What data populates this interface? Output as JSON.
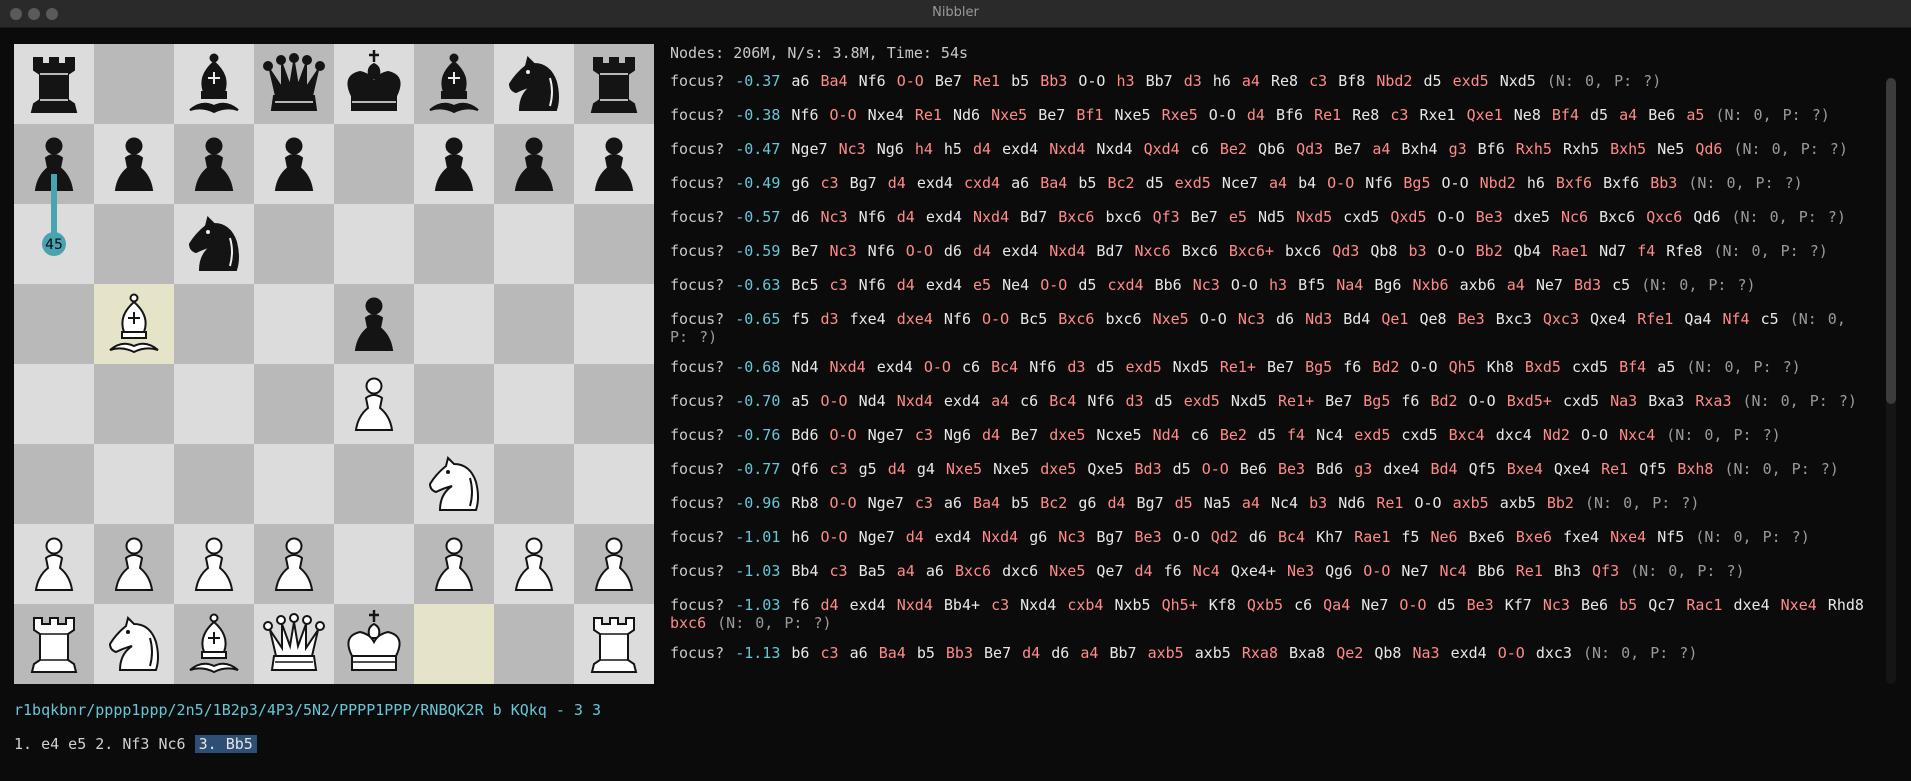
{
  "window": {
    "title": "Nibbler"
  },
  "info": {
    "text": "Nodes: 206M, N/s: 3.8M, Time: 54s"
  },
  "board": {
    "rows": [
      [
        "r",
        "",
        "b",
        "q",
        "k",
        "b",
        "n",
        "r"
      ],
      [
        "p",
        "p",
        "p",
        "p",
        "",
        "p",
        "p",
        "p"
      ],
      [
        "",
        "",
        "n",
        "",
        "",
        "",
        "",
        ""
      ],
      [
        "",
        "B",
        "",
        "",
        "p",
        "",
        "",
        ""
      ],
      [
        "",
        "",
        "",
        "",
        "P",
        "",
        "",
        ""
      ],
      [
        "",
        "",
        "",
        "",
        "",
        "N",
        "",
        ""
      ],
      [
        "P",
        "P",
        "P",
        "P",
        "",
        "P",
        "P",
        "P"
      ],
      [
        "R",
        "N",
        "B",
        "Q",
        "K",
        "",
        "",
        "R"
      ]
    ],
    "highlight": [
      "b5",
      "f1"
    ],
    "arrow": {
      "from": "a7",
      "to": "a6",
      "label": "45",
      "color": "#4aa3b0"
    }
  },
  "colors": {
    "score": "#66c6d6",
    "white_move": "#e8e8e8",
    "black_move": "#ff8a8a",
    "fen": "#66c6d6",
    "current_move_bg": "#2c4f73"
  },
  "pv_lines": [
    {
      "label": "focus?",
      "score": "-0.37",
      "moves": [
        "a6",
        "Ba4",
        "Nf6",
        "O-O",
        "Be7",
        "Re1",
        "b5",
        "Bb3",
        "O-O",
        "h3",
        "Bb7",
        "d3",
        "h6",
        "a4",
        "Re8",
        "c3",
        "Bf8",
        "Nbd2",
        "d5",
        "exd5",
        "Nxd5"
      ],
      "stats": "(N: 0, P: ?)"
    },
    {
      "label": "focus?",
      "score": "-0.38",
      "moves": [
        "Nf6",
        "O-O",
        "Nxe4",
        "Re1",
        "Nd6",
        "Nxe5",
        "Be7",
        "Bf1",
        "Nxe5",
        "Rxe5",
        "O-O",
        "d4",
        "Bf6",
        "Re1",
        "Re8",
        "c3",
        "Rxe1",
        "Qxe1",
        "Ne8",
        "Bf4",
        "d5",
        "a4",
        "Be6",
        "a5"
      ],
      "stats": "(N: 0, P: ?)"
    },
    {
      "label": "focus?",
      "score": "-0.47",
      "moves": [
        "Nge7",
        "Nc3",
        "Ng6",
        "h4",
        "h5",
        "d4",
        "exd4",
        "Nxd4",
        "Nxd4",
        "Qxd4",
        "c6",
        "Be2",
        "Qb6",
        "Qd3",
        "Be7",
        "a4",
        "Bxh4",
        "g3",
        "Bf6",
        "Rxh5",
        "Rxh5",
        "Bxh5",
        "Ne5",
        "Qd6"
      ],
      "stats": "(N: 0, P: ?)"
    },
    {
      "label": "focus?",
      "score": "-0.49",
      "moves": [
        "g6",
        "c3",
        "Bg7",
        "d4",
        "exd4",
        "cxd4",
        "a6",
        "Ba4",
        "b5",
        "Bc2",
        "d5",
        "exd5",
        "Nce7",
        "a4",
        "b4",
        "O-O",
        "Nf6",
        "Bg5",
        "O-O",
        "Nbd2",
        "h6",
        "Bxf6",
        "Bxf6",
        "Bb3"
      ],
      "stats": "(N: 0, P: ?)"
    },
    {
      "label": "focus?",
      "score": "-0.57",
      "moves": [
        "d6",
        "Nc3",
        "Nf6",
        "d4",
        "exd4",
        "Nxd4",
        "Bd7",
        "Bxc6",
        "bxc6",
        "Qf3",
        "Be7",
        "e5",
        "Nd5",
        "Nxd5",
        "cxd5",
        "Qxd5",
        "O-O",
        "Be3",
        "dxe5",
        "Nc6",
        "Bxc6",
        "Qxc6",
        "Qd6"
      ],
      "stats": "(N: 0, P: ?)"
    },
    {
      "label": "focus?",
      "score": "-0.59",
      "moves": [
        "Be7",
        "Nc3",
        "Nf6",
        "O-O",
        "d6",
        "d4",
        "exd4",
        "Nxd4",
        "Bd7",
        "Nxc6",
        "Bxc6",
        "Bxc6+",
        "bxc6",
        "Qd3",
        "Qb8",
        "b3",
        "O-O",
        "Bb2",
        "Qb4",
        "Rae1",
        "Nd7",
        "f4",
        "Rfe8"
      ],
      "stats": "(N: 0, P: ?)"
    },
    {
      "label": "focus?",
      "score": "-0.63",
      "moves": [
        "Bc5",
        "c3",
        "Nf6",
        "d4",
        "exd4",
        "e5",
        "Ne4",
        "O-O",
        "d5",
        "cxd4",
        "Bb6",
        "Nc3",
        "O-O",
        "h3",
        "Bf5",
        "Na4",
        "Bg6",
        "Nxb6",
        "axb6",
        "a4",
        "Ne7",
        "Bd3",
        "c5"
      ],
      "stats": "(N: 0, P: ?)"
    },
    {
      "label": "focus?",
      "score": "-0.65",
      "moves": [
        "f5",
        "d3",
        "fxe4",
        "dxe4",
        "Nf6",
        "O-O",
        "Bc5",
        "Bxc6",
        "bxc6",
        "Nxe5",
        "O-O",
        "Nc3",
        "d6",
        "Nd3",
        "Bd4",
        "Qe1",
        "Qe8",
        "Be3",
        "Bxc3",
        "Qxc3",
        "Qxe4",
        "Rfe1",
        "Qa4",
        "Nf4",
        "c5"
      ],
      "stats": "(N: 0, P: ?)",
      "tight": true
    },
    {
      "label": "focus?",
      "score": "-0.68",
      "moves": [
        "Nd4",
        "Nxd4",
        "exd4",
        "O-O",
        "c6",
        "Bc4",
        "Nf6",
        "d3",
        "d5",
        "exd5",
        "Nxd5",
        "Re1+",
        "Be7",
        "Bg5",
        "f6",
        "Bd2",
        "O-O",
        "Qh5",
        "Kh8",
        "Bxd5",
        "cxd5",
        "Bf4",
        "a5"
      ],
      "stats": "(N: 0, P: ?)"
    },
    {
      "label": "focus?",
      "score": "-0.70",
      "moves": [
        "a5",
        "O-O",
        "Nd4",
        "Nxd4",
        "exd4",
        "a4",
        "c6",
        "Bc4",
        "Nf6",
        "d3",
        "d5",
        "exd5",
        "Nxd5",
        "Re1+",
        "Be7",
        "Bg5",
        "f6",
        "Bd2",
        "O-O",
        "Bxd5+",
        "cxd5",
        "Na3",
        "Bxa3",
        "Rxa3"
      ],
      "stats": "(N: 0, P: ?)"
    },
    {
      "label": "focus?",
      "score": "-0.76",
      "moves": [
        "Bd6",
        "O-O",
        "Nge7",
        "c3",
        "Ng6",
        "d4",
        "Be7",
        "dxe5",
        "Ncxe5",
        "Nd4",
        "c6",
        "Be2",
        "d5",
        "f4",
        "Nc4",
        "exd5",
        "cxd5",
        "Bxc4",
        "dxc4",
        "Nd2",
        "O-O",
        "Nxc4"
      ],
      "stats": "(N: 0, P: ?)"
    },
    {
      "label": "focus?",
      "score": "-0.77",
      "moves": [
        "Qf6",
        "c3",
        "g5",
        "d4",
        "g4",
        "Nxe5",
        "Nxe5",
        "dxe5",
        "Qxe5",
        "Bd3",
        "d5",
        "O-O",
        "Be6",
        "Be3",
        "Bd6",
        "g3",
        "dxe4",
        "Bd4",
        "Qf5",
        "Bxe4",
        "Qxe4",
        "Re1",
        "Qf5",
        "Bxh8"
      ],
      "stats": "(N: 0, P: ?)"
    },
    {
      "label": "focus?",
      "score": "-0.96",
      "moves": [
        "Rb8",
        "O-O",
        "Nge7",
        "c3",
        "a6",
        "Ba4",
        "b5",
        "Bc2",
        "g6",
        "d4",
        "Bg7",
        "d5",
        "Na5",
        "a4",
        "Nc4",
        "b3",
        "Nd6",
        "Re1",
        "O-O",
        "axb5",
        "axb5",
        "Bb2"
      ],
      "stats": "(N: 0, P: ?)"
    },
    {
      "label": "focus?",
      "score": "-1.01",
      "moves": [
        "h6",
        "O-O",
        "Nge7",
        "d4",
        "exd4",
        "Nxd4",
        "g6",
        "Nc3",
        "Bg7",
        "Be3",
        "O-O",
        "Qd2",
        "d6",
        "Bc4",
        "Kh7",
        "Rae1",
        "f5",
        "Ne6",
        "Bxe6",
        "Bxe6",
        "fxe4",
        "Nxe4",
        "Nf5"
      ],
      "stats": "(N: 0, P: ?)"
    },
    {
      "label": "focus?",
      "score": "-1.03",
      "moves": [
        "Bb4",
        "c3",
        "Ba5",
        "a4",
        "a6",
        "Bxc6",
        "dxc6",
        "Nxe5",
        "Qe7",
        "d4",
        "f6",
        "Nc4",
        "Qxe4+",
        "Ne3",
        "Qg6",
        "O-O",
        "Ne7",
        "Nc4",
        "Bb6",
        "Re1",
        "Bh3",
        "Qf3"
      ],
      "stats": "(N: 0, P: ?)"
    },
    {
      "label": "focus?",
      "score": "-1.03",
      "moves": [
        "f6",
        "d4",
        "exd4",
        "Nxd4",
        "Bb4+",
        "c3",
        "Nxd4",
        "cxb4",
        "Nxb5",
        "Qh5+",
        "Kf8",
        "Qxb5",
        "c6",
        "Qa4",
        "Ne7",
        "O-O",
        "d5",
        "Be3",
        "Kf7",
        "Nc3",
        "Be6",
        "b5",
        "Qc7",
        "Rac1",
        "dxe4",
        "Nxe4",
        "Rhd8",
        "bxc6"
      ],
      "stats": "(N: 0, P: ?)",
      "tight": true
    },
    {
      "label": "focus?",
      "score": "-1.13",
      "moves": [
        "b6",
        "c3",
        "a6",
        "Ba4",
        "b5",
        "Bb3",
        "Be7",
        "d4",
        "d6",
        "a4",
        "Bb7",
        "axb5",
        "axb5",
        "Rxa8",
        "Bxa8",
        "Qe2",
        "Qb8",
        "Na3",
        "exd4",
        "O-O",
        "dxc3"
      ],
      "stats": "(N: 0, P: ?)"
    }
  ],
  "fen": "r1bqkbnr/pppp1ppp/2n5/1B2p3/4P3/5N2/PPPP1PPP/RNBQK2R b KQkq - 3 3",
  "moves_played": {
    "prefix": "1. e4 e5 2. Nf3 Nc6 ",
    "current": "3. Bb5"
  }
}
